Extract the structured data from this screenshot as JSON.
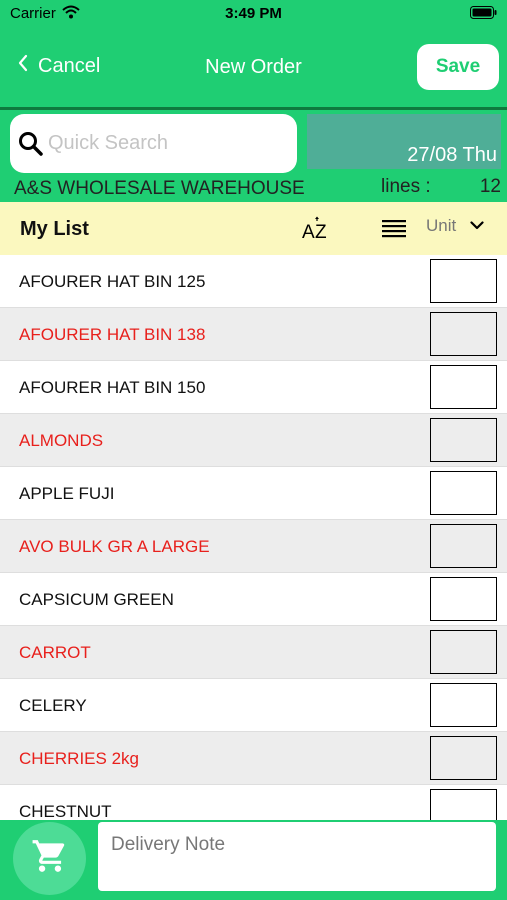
{
  "status_bar": {
    "carrier": "Carrier",
    "time": "3:49 PM"
  },
  "navbar": {
    "cancel_label": "Cancel",
    "title": "New Order",
    "save_label": "Save"
  },
  "search": {
    "placeholder": "Quick Search"
  },
  "order_info": {
    "date": "27/08 Thu",
    "store_name": "A&S WHOLESALE WAREHOUSE",
    "lines_label": "lines :",
    "lines_count": "12"
  },
  "list_bar": {
    "title": "My List",
    "unit_label": "Unit"
  },
  "items": [
    {
      "name": "AFOURER HAT BIN  125",
      "color": "#111111"
    },
    {
      "name": "AFOURER HAT BIN 138",
      "color": "#e8201c"
    },
    {
      "name": "AFOURER HAT BIN 150",
      "color": "#111111"
    },
    {
      "name": "ALMONDS",
      "color": "#e8201c"
    },
    {
      "name": "APPLE FUJI",
      "color": "#111111"
    },
    {
      "name": "AVO BULK GR A  LARGE",
      "color": "#e8201c"
    },
    {
      "name": "CAPSICUM GREEN",
      "color": "#111111"
    },
    {
      "name": "CARROT",
      "color": "#e8201c"
    },
    {
      "name": "CELERY",
      "color": "#111111"
    },
    {
      "name": "CHERRIES 2kg",
      "color": "#e8201c"
    },
    {
      "name": "CHESTNUT",
      "color": "#111111"
    }
  ],
  "footer": {
    "note_placeholder": "Delivery Note"
  },
  "colors": {
    "brand_green": "#1fce73",
    "date_box": "#4fae97",
    "list_bar": "#fbf8bf",
    "item_red": "#e8201c"
  },
  "icons": [
    "chevron-left-icon",
    "wifi-icon",
    "battery-icon",
    "search-icon",
    "sort-az-icon",
    "list-view-icon",
    "chevron-down-icon",
    "cart-icon"
  ]
}
